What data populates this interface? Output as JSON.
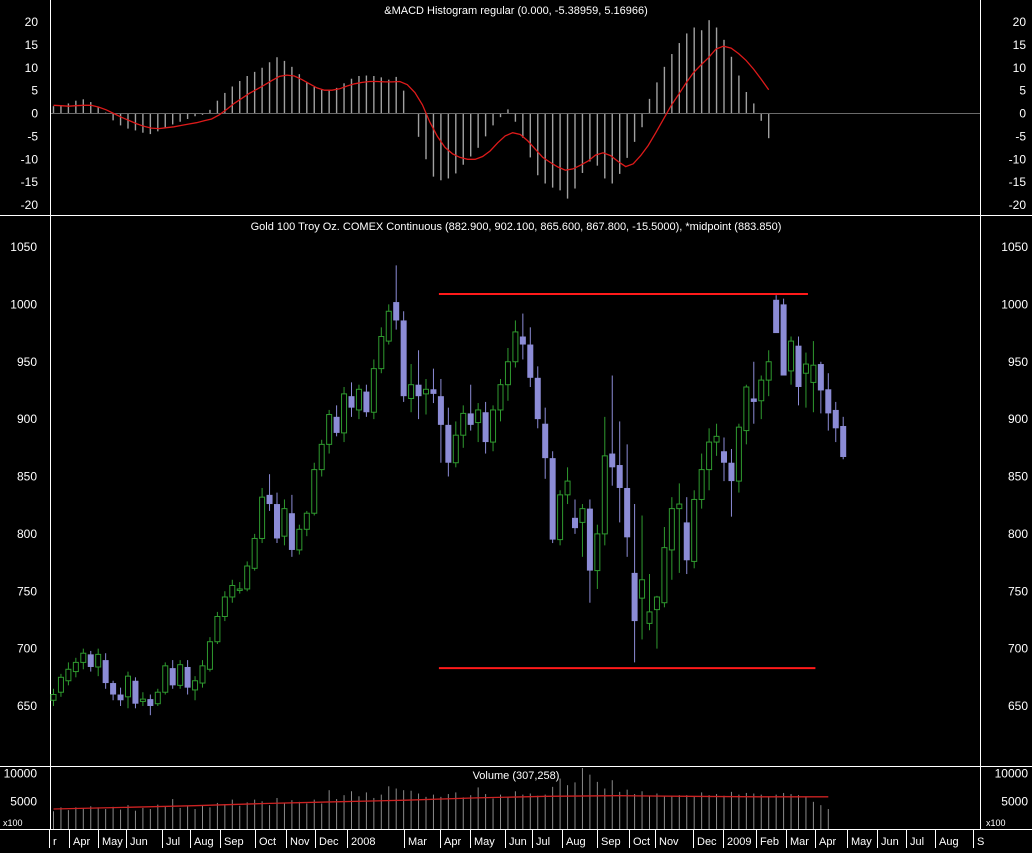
{
  "panels": {
    "macd": {
      "title": "&MACD Histogram regular (0.000, -5.38959, 5.16966)",
      "yticks": [
        "20",
        "15",
        "10",
        "5",
        "0",
        "-5",
        "-10",
        "-15",
        "-20"
      ]
    },
    "price": {
      "title": "Gold 100 Troy Oz. COMEX Continuous (882.900, 902.100, 865.600, 867.800, -15.5000), *midpoint (883.850)",
      "yticks": [
        "1050",
        "1000",
        "950",
        "900",
        "850",
        "800",
        "750",
        "700",
        "650"
      ]
    },
    "volume": {
      "title": "Volume (307,258)",
      "yticks": [
        "10000",
        "5000"
      ],
      "multiplier_label": "x100"
    }
  },
  "x_axis_labels": [
    "r",
    "Apr",
    "May",
    "Jun",
    "Jul",
    "Aug",
    "Sep",
    "Oct",
    "Nov",
    "Dec",
    "2008",
    "Mar",
    "Apr",
    "May",
    "Jun",
    "Jul",
    "Aug",
    "Sep",
    "Oct",
    "Nov",
    "Dec",
    "2009",
    "Feb",
    "Mar",
    "Apr",
    "May",
    "Jun",
    "Jul",
    "Aug",
    "S"
  ],
  "colors": {
    "background": "#000000",
    "up_candle": "#2f9a2f",
    "down_candle": "#8c8cd6",
    "resistance_support": "#ff1a1a",
    "macd_signal": "#dd1a1a",
    "histogram": "#a0a0a0",
    "volume_bars": "#8a8a8a",
    "volume_average": "#cc2222",
    "axis_text": "#ffffff"
  },
  "chart_data": [
    {
      "type": "bar",
      "title": "&MACD Histogram regular (0.000, -5.38959, 5.16966)",
      "ylim": [
        -21,
        22
      ],
      "grid": false,
      "series": [
        {
          "kind": "histogram",
          "values": [
            1.6,
            1.8,
            2.2,
            2.8,
            3.1,
            2.5,
            1.5,
            0.2,
            -1.5,
            -2.6,
            -3.3,
            -3.7,
            -4.2,
            -4.5,
            -3.9,
            -3.1,
            -2.4,
            -1.8,
            -1.2,
            -0.6,
            -0.3,
            0.8,
            2.8,
            4.5,
            5.9,
            7.1,
            8.2,
            9.1,
            10.0,
            11.2,
            12.3,
            11.5,
            10.2,
            8.6,
            6.9,
            5.8,
            5.2,
            5.1,
            5.6,
            6.6,
            7.6,
            8.2,
            8.3,
            8.2,
            7.9,
            7.4,
            8.0,
            5.0,
            0.1,
            -5.1,
            -10.0,
            -13.8,
            -14.6,
            -14.2,
            -13.1,
            -11.2,
            -9.4,
            -7.5,
            -5.0,
            -2.6,
            -0.8,
            0.9,
            -1.8,
            -5.3,
            -9.6,
            -13.5,
            -15.3,
            -16.2,
            -16.8,
            -18.6,
            -16.4,
            -13.0,
            -10.5,
            -11.4,
            -14.2,
            -15.3,
            -13.2,
            -9.7,
            -6.2,
            -3.0,
            3.2,
            6.8,
            10.2,
            13.0,
            15.4,
            17.5,
            18.8,
            18.2,
            20.4,
            18.8,
            16.1,
            12.4,
            8.3,
            4.7,
            2.2,
            -1.6,
            -5.4
          ]
        },
        {
          "kind": "signal",
          "values": [
            1.8,
            1.7,
            1.6,
            1.7,
            1.8,
            1.8,
            1.4,
            0.8,
            0.0,
            -0.8,
            -1.5,
            -2.2,
            -2.8,
            -3.2,
            -3.3,
            -3.1,
            -2.9,
            -2.6,
            -2.3,
            -2.0,
            -1.6,
            -1.2,
            -0.3,
            0.9,
            2.2,
            3.3,
            4.4,
            5.3,
            6.2,
            7.2,
            8.1,
            8.4,
            8.2,
            7.4,
            6.5,
            5.6,
            5.1,
            5.1,
            5.4,
            6.0,
            6.5,
            6.8,
            7.0,
            7.0,
            6.9,
            6.9,
            7.0,
            6.3,
            4.6,
            1.9,
            -1.9,
            -5.0,
            -7.4,
            -8.8,
            -9.6,
            -10.0,
            -10.0,
            -9.4,
            -8.2,
            -6.4,
            -4.9,
            -4.2,
            -4.6,
            -6.0,
            -7.8,
            -9.6,
            -10.7,
            -11.7,
            -12.4,
            -12.1,
            -11.3,
            -10.4,
            -9.1,
            -8.6,
            -9.2,
            -10.5,
            -11.6,
            -11.0,
            -9.2,
            -7.0,
            -4.2,
            -1.3,
            1.6,
            4.1,
            6.6,
            8.9,
            10.6,
            12.2,
            14.1,
            14.7,
            14.3,
            13.1,
            11.6,
            9.7,
            7.5,
            5.2
          ]
        }
      ]
    },
    {
      "type": "candlestick",
      "title": "Gold 100 Troy Oz. COMEX Continuous (882.900, 902.100, 865.600, 867.800, -15.5000), *midpoint (883.850)",
      "ylim": [
        618,
        1068
      ],
      "grid": false,
      "x_labels": [
        "r",
        "Apr",
        "May",
        "Jun",
        "Jul",
        "Aug",
        "Sep",
        "Oct",
        "Nov",
        "Dec",
        "2008",
        "Mar",
        "Apr",
        "May",
        "Jun",
        "Jul",
        "Aug",
        "Sep",
        "Oct",
        "Nov",
        "Dec",
        "2009",
        "Feb",
        "Mar",
        "Apr",
        "May",
        "Jun",
        "Jul",
        "Aug",
        "S"
      ],
      "ohlc": [
        [
          655,
          665,
          650,
          660
        ],
        [
          662,
          678,
          658,
          675
        ],
        [
          672,
          688,
          668,
          682
        ],
        [
          680,
          692,
          675,
          688
        ],
        [
          688,
          700,
          682,
          696
        ],
        [
          695,
          698,
          680,
          684
        ],
        [
          684,
          700,
          676,
          695
        ],
        [
          690,
          696,
          665,
          670
        ],
        [
          670,
          672,
          655,
          660
        ],
        [
          660,
          666,
          650,
          655
        ],
        [
          658,
          680,
          648,
          676
        ],
        [
          672,
          675,
          648,
          652
        ],
        [
          654,
          662,
          650,
          656
        ],
        [
          656,
          660,
          642,
          650
        ],
        [
          652,
          665,
          650,
          662
        ],
        [
          662,
          688,
          660,
          685
        ],
        [
          683,
          690,
          665,
          668
        ],
        [
          668,
          690,
          665,
          686
        ],
        [
          684,
          690,
          660,
          666
        ],
        [
          664,
          676,
          655,
          672
        ],
        [
          670,
          690,
          666,
          685
        ],
        [
          682,
          710,
          680,
          706
        ],
        [
          706,
          732,
          704,
          728
        ],
        [
          728,
          750,
          724,
          745
        ],
        [
          745,
          760,
          740,
          755
        ],
        [
          752,
          758,
          748,
          752
        ],
        [
          752,
          776,
          750,
          772
        ],
        [
          770,
          800,
          768,
          796
        ],
        [
          796,
          840,
          792,
          832
        ],
        [
          834,
          852,
          820,
          826
        ],
        [
          826,
          836,
          792,
          796
        ],
        [
          798,
          830,
          790,
          822
        ],
        [
          818,
          834,
          780,
          786
        ],
        [
          786,
          808,
          782,
          804
        ],
        [
          804,
          820,
          798,
          818
        ],
        [
          818,
          862,
          816,
          856
        ],
        [
          856,
          882,
          850,
          878
        ],
        [
          878,
          908,
          870,
          904
        ],
        [
          902,
          912,
          885,
          888
        ],
        [
          888,
          928,
          880,
          922
        ],
        [
          920,
          932,
          902,
          910
        ],
        [
          908,
          930,
          900,
          926
        ],
        [
          924,
          930,
          902,
          906
        ],
        [
          906,
          952,
          900,
          944
        ],
        [
          944,
          980,
          940,
          972
        ],
        [
          968,
          1000,
          965,
          994
        ],
        [
          1002,
          1034,
          978,
          986
        ],
        [
          986,
          994,
          915,
          920
        ],
        [
          918,
          948,
          906,
          930
        ],
        [
          930,
          960,
          900,
          920
        ],
        [
          922,
          935,
          904,
          926
        ],
        [
          926,
          944,
          914,
          922
        ],
        [
          920,
          935,
          862,
          895
        ],
        [
          895,
          910,
          850,
          862
        ],
        [
          862,
          898,
          858,
          886
        ],
        [
          886,
          912,
          875,
          905
        ],
        [
          905,
          930,
          890,
          895
        ],
        [
          897,
          914,
          880,
          908
        ],
        [
          906,
          915,
          870,
          880
        ],
        [
          880,
          912,
          872,
          908
        ],
        [
          908,
          935,
          898,
          930
        ],
        [
          930,
          962,
          916,
          950
        ],
        [
          950,
          986,
          945,
          976
        ],
        [
          972,
          992,
          952,
          965
        ],
        [
          965,
          980,
          928,
          936
        ],
        [
          936,
          946,
          892,
          900
        ],
        [
          896,
          910,
          848,
          866
        ],
        [
          866,
          872,
          792,
          795
        ],
        [
          795,
          838,
          790,
          834
        ],
        [
          834,
          858,
          826,
          846
        ],
        [
          814,
          830,
          800,
          805
        ],
        [
          810,
          826,
          780,
          822
        ],
        [
          822,
          830,
          740,
          768
        ],
        [
          768,
          808,
          752,
          800
        ],
        [
          800,
          902,
          790,
          868
        ],
        [
          870,
          938,
          842,
          858
        ],
        [
          860,
          898,
          810,
          840
        ],
        [
          840,
          878,
          780,
          797
        ],
        [
          766,
          826,
          688,
          724
        ],
        [
          744,
          816,
          708,
          760
        ],
        [
          722,
          765,
          716,
          732
        ],
        [
          734,
          746,
          700,
          745
        ],
        [
          740,
          806,
          736,
          788
        ],
        [
          786,
          832,
          760,
          822
        ],
        [
          822,
          844,
          766,
          826
        ],
        [
          810,
          832,
          765,
          777
        ],
        [
          776,
          838,
          770,
          830
        ],
        [
          830,
          870,
          822,
          856
        ],
        [
          856,
          892,
          838,
          880
        ],
        [
          880,
          896,
          868,
          885
        ],
        [
          872,
          884,
          846,
          862
        ],
        [
          862,
          874,
          815,
          846
        ],
        [
          846,
          896,
          836,
          893
        ],
        [
          890,
          930,
          878,
          928
        ],
        [
          918,
          950,
          896,
          915
        ],
        [
          916,
          938,
          900,
          934
        ],
        [
          934,
          960,
          920,
          950
        ],
        [
          1004,
          1008,
          978,
          975
        ],
        [
          1000,
          1005,
          940,
          938
        ],
        [
          942,
          972,
          930,
          968
        ],
        [
          964,
          972,
          912,
          928
        ],
        [
          940,
          958,
          910,
          948
        ],
        [
          932,
          968,
          906,
          947
        ],
        [
          948,
          950,
          905,
          925
        ],
        [
          926,
          940,
          890,
          905
        ],
        [
          908,
          915,
          880,
          892
        ],
        [
          894,
          902,
          865,
          867
        ]
      ],
      "annotations": [
        {
          "kind": "resistance_line",
          "value": 1009,
          "from_bar": 52,
          "to_bar": 101
        },
        {
          "kind": "support_line",
          "value": 683,
          "from_bar": 52,
          "to_bar": 102
        }
      ]
    },
    {
      "type": "bar",
      "title": "Volume (307,258)",
      "ylim": [
        0,
        11000
      ],
      "unit": "x100",
      "series": [
        {
          "kind": "volume",
          "values": [
            3200,
            3900,
            3400,
            3900,
            3700,
            4100,
            3900,
            3600,
            4000,
            3500,
            4300,
            3300,
            3800,
            3600,
            4400,
            4000,
            5400,
            3800,
            4200,
            3600,
            4300,
            3900,
            4700,
            4500,
            5300,
            4200,
            4800,
            5300,
            5000,
            4300,
            5600,
            4700,
            5200,
            4900,
            4600,
            5300,
            4600,
            7000,
            5400,
            6100,
            6800,
            5900,
            6600,
            5600,
            6200,
            7700,
            7300,
            7000,
            6900,
            6400,
            5800,
            6200,
            5800,
            6300,
            6600,
            5700,
            6100,
            7500,
            6300,
            5500,
            6200,
            5700,
            6800,
            6200,
            6400,
            6000,
            6200,
            7600,
            9100,
            7900,
            8400,
            11000,
            9800,
            8500,
            7300,
            8800,
            6700,
            7100,
            6300,
            6800,
            5900,
            6400,
            6000,
            5900,
            6100,
            6100,
            5800,
            6600,
            6100,
            6300,
            6000,
            6700,
            6200,
            6500,
            6400,
            6200,
            5900,
            6200,
            6500,
            6300,
            6100,
            5700,
            4900,
            4300,
            3600
          ]
        },
        {
          "kind": "average",
          "values": [
            3600,
            3900,
            4200,
            4600,
            4900,
            5200,
            5600,
            5900,
            6000,
            5900,
            5800,
            5800
          ]
        }
      ]
    }
  ]
}
